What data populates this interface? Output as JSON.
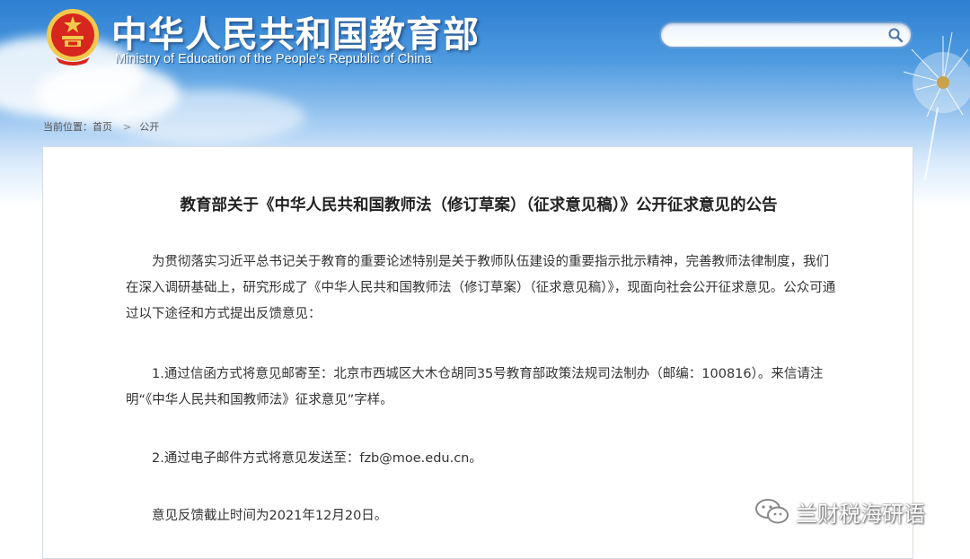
{
  "header": {
    "title": "中华人民共和国教育部",
    "subtitle": "Ministry of Education of the People's Republic of China",
    "emblem_icon": "national-emblem-icon",
    "colors": {
      "sky": "#4f9be0",
      "emblem_red": "#d7261d",
      "emblem_gold": "#f2c94c"
    }
  },
  "search": {
    "value": "",
    "placeholder": "",
    "icon": "search-icon"
  },
  "breadcrumb": {
    "prefix": "当前位置：",
    "home": "首页",
    "separator": ">",
    "current": "公开"
  },
  "article": {
    "title": "教育部关于《中华人民共和国教师法（修订草案）（征求意见稿）》公开征求意见的公告",
    "paragraphs": [
      "为贯彻落实习近平总书记关于教育的重要论述特别是关于教师队伍建设的重要指示批示精神，完善教师法律制度，我们在深入调研基础上，研究形成了《中华人民共和国教师法（修订草案）（征求意见稿）》，现面向社会公开征求意见。公众可通过以下途径和方式提出反馈意见：",
      "1.通过信函方式将意见邮寄至：北京市西城区大木仓胡同35号教育部政策法规司法制办（邮编：100816）。来信请注明“《中华人民共和国教师法》征求意见”字样。",
      "2.通过电子邮件方式将意见发送至：fzb@moe.edu.cn。",
      "意见反馈截止时间为2021年12月20日。"
    ]
  },
  "watermark": {
    "icon": "wechat-icon",
    "text": "兰财税海研语"
  }
}
